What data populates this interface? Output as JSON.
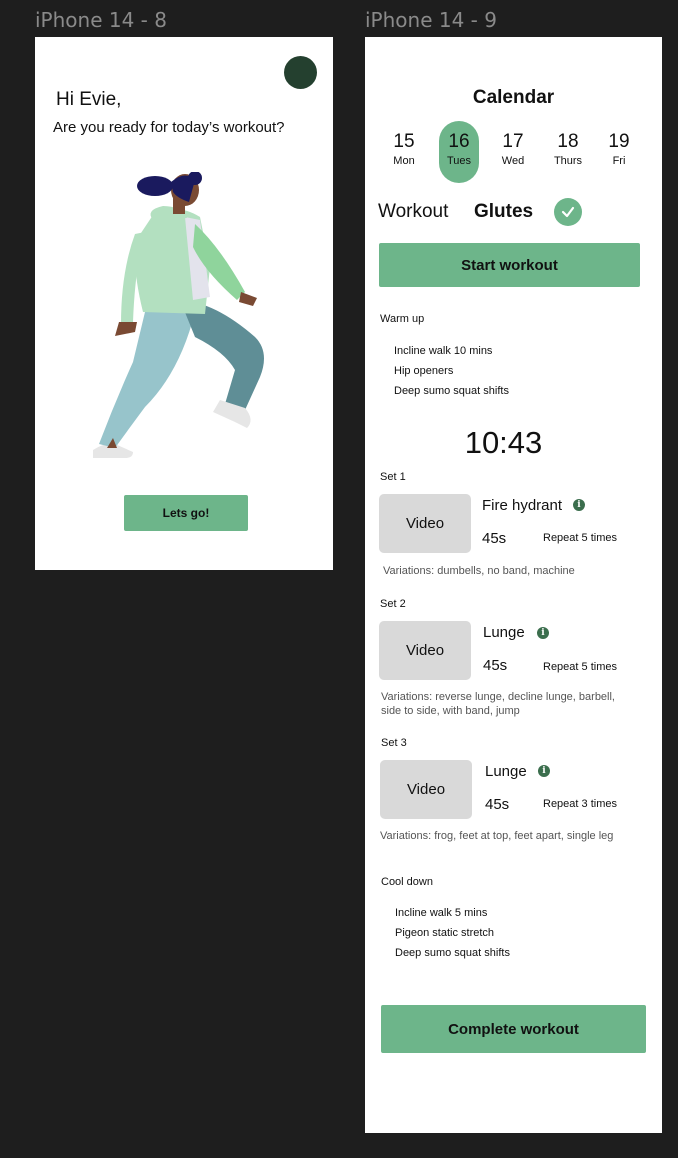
{
  "frames": {
    "frame1_label": "iPhone 14 - 8",
    "frame2_label": "iPhone 14 - 9"
  },
  "home": {
    "greeting": "Hi Evie,",
    "question": "Are you ready for today’s workout?",
    "cta": "Lets go!",
    "colors": {
      "accent": "#6db58a",
      "avatar": "#24402f"
    }
  },
  "calendar": {
    "title": "Calendar",
    "days": [
      {
        "num": "15",
        "name": "Mon"
      },
      {
        "num": "16",
        "name": "Tues"
      },
      {
        "num": "17",
        "name": "Wed"
      },
      {
        "num": "18",
        "name": "Thurs"
      },
      {
        "num": "19",
        "name": "Fri"
      }
    ],
    "selected_day": "16"
  },
  "workout": {
    "label": "Workout",
    "name": "Glutes",
    "start_label": "Start workout",
    "warmup": {
      "heading": "Warm up",
      "items": [
        "Incline walk 10 mins",
        "Hip openers",
        "Deep sumo squat shifts"
      ]
    },
    "timer": "10:43",
    "sets": [
      {
        "label": "Set 1",
        "video": "Video",
        "exercise": "Fire hydrant",
        "duration": "45s",
        "repeat": "Repeat 5 times",
        "variations": "Variations: dumbells, no band, machine"
      },
      {
        "label": "Set 2",
        "video": "Video",
        "exercise": "Lunge",
        "duration": "45s",
        "repeat": "Repeat 5 times",
        "variations_line1": "Variations: reverse lunge, decline lunge, barbell,",
        "variations_line2": "side to side, with band, jump"
      },
      {
        "label": "Set 3",
        "video": "Video",
        "exercise": "Lunge",
        "duration": "45s",
        "repeat": "Repeat 3 times",
        "variations": "Variations: frog, feet at top, feet apart, single leg"
      }
    ],
    "cooldown": {
      "heading": "Cool down",
      "items": [
        "Incline walk 5 mins",
        "Pigeon static stretch",
        "Deep sumo squat shifts"
      ]
    },
    "complete_label": "Complete workout",
    "info_glyph": "i"
  }
}
